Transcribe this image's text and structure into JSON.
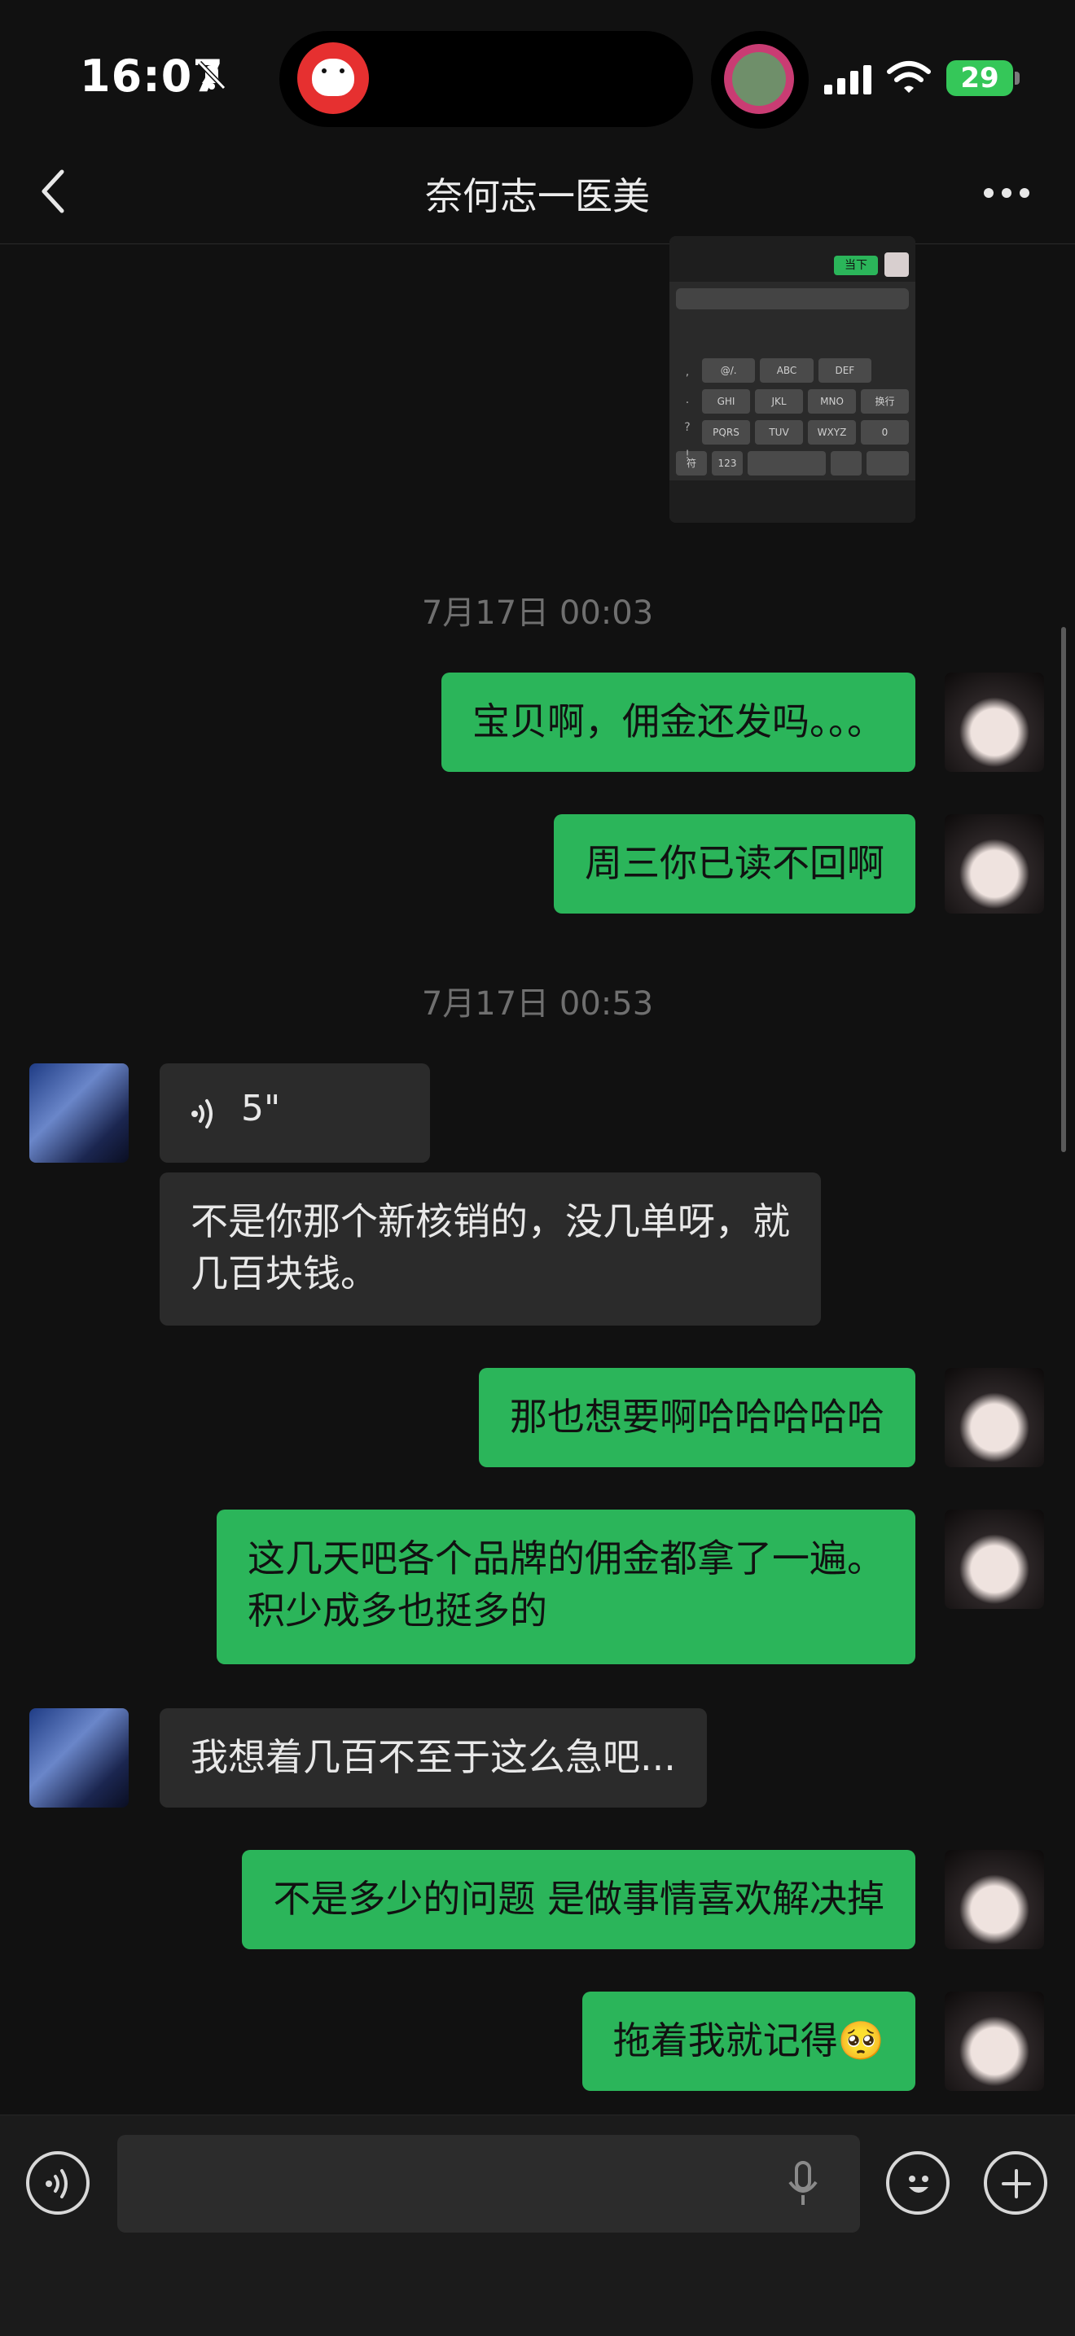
{
  "status_bar": {
    "time": "16:07",
    "battery": "29"
  },
  "nav": {
    "title": "奈何志一医美"
  },
  "embedded_screenshot": {
    "chip": "当下",
    "keys_row1": [
      "@/.",
      "ABC",
      "DEF"
    ],
    "keys_row2": [
      "GHI",
      "JKL",
      "MNO",
      "换行"
    ],
    "keys_row3": [
      "PQRS",
      "TUV",
      "WXYZ",
      "0"
    ],
    "keys_row4": [
      "符",
      "123"
    ],
    "side": [
      ",",
      ".",
      "?",
      "!"
    ]
  },
  "messages": {
    "ts1": "7月17日 00:03",
    "m1": "宝贝啊，佣金还发吗。。。",
    "m2": "周三你已读不回啊",
    "ts2": "7月17日 00:53",
    "voice_duration": "5\"",
    "m3_line1": "不是你那个新核销的，没几单呀，就",
    "m3_line2": "几百块钱。",
    "m4": "那也想要啊哈哈哈哈哈",
    "m5_line1": "这几天吧各个品牌的佣金都拿了一遍。",
    "m5_line2": "积少成多也挺多的",
    "m6": "我想着几百不至于这么急吧...",
    "m7": "不是多少的问题  是做事情喜欢解决掉",
    "m8": "拖着我就记得",
    "m8_emoji": "🥺"
  },
  "colors": {
    "accent_green": "#2bb55a",
    "bubble_other": "#2b2b2b",
    "background": "#111111"
  }
}
